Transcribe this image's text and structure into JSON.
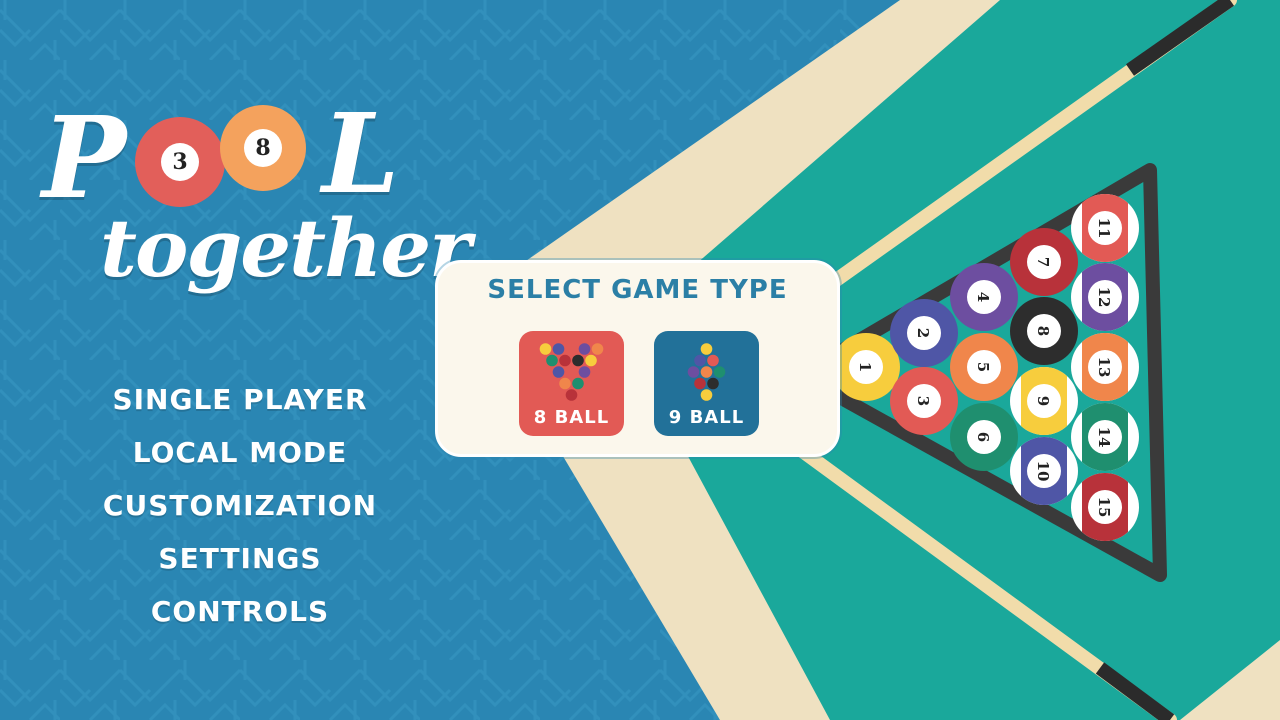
{
  "logo": {
    "word_p": "P",
    "ball_left": "3",
    "ball_right": "8",
    "word_l": "L",
    "word_together": "together"
  },
  "menu": [
    {
      "label": "SINGLE PLAYER"
    },
    {
      "label": "LOCAL MODE"
    },
    {
      "label": "CUSTOMIZATION"
    },
    {
      "label": "SETTINGS"
    },
    {
      "label": "CONTROLS"
    }
  ],
  "dialog": {
    "title": "SELECT GAME TYPE",
    "options": [
      {
        "label": "8 BALL"
      },
      {
        "label": "9 BALL"
      }
    ]
  },
  "rack_balls": [
    {
      "number": "1",
      "color": "#f7cd3d",
      "stripe": false
    },
    {
      "number": "2",
      "color": "#4f56a6",
      "stripe": false
    },
    {
      "number": "3",
      "color": "#e25a55",
      "stripe": false
    },
    {
      "number": "4",
      "color": "#6d4ea0",
      "stripe": false
    },
    {
      "number": "5",
      "color": "#f0864b",
      "stripe": false
    },
    {
      "number": "6",
      "color": "#1f8f6f",
      "stripe": false
    },
    {
      "number": "7",
      "color": "#b8323a",
      "stripe": false
    },
    {
      "number": "8",
      "color": "#2d2d2d",
      "stripe": false
    },
    {
      "number": "9",
      "color": "#f7cd3d",
      "stripe": true
    },
    {
      "number": "10",
      "color": "#4f56a6",
      "stripe": true
    },
    {
      "number": "11",
      "color": "#e25a55",
      "stripe": true
    },
    {
      "number": "12",
      "color": "#6d4ea0",
      "stripe": true
    },
    {
      "number": "13",
      "color": "#f0864b",
      "stripe": true
    },
    {
      "number": "14",
      "color": "#1f8f6f",
      "stripe": true
    },
    {
      "number": "15",
      "color": "#b8323a",
      "stripe": true
    }
  ],
  "colors": {
    "background": "#2a86b3",
    "felt": "#1aa89b",
    "rail": "#efe1c1",
    "rack": "#3a3a3a"
  }
}
